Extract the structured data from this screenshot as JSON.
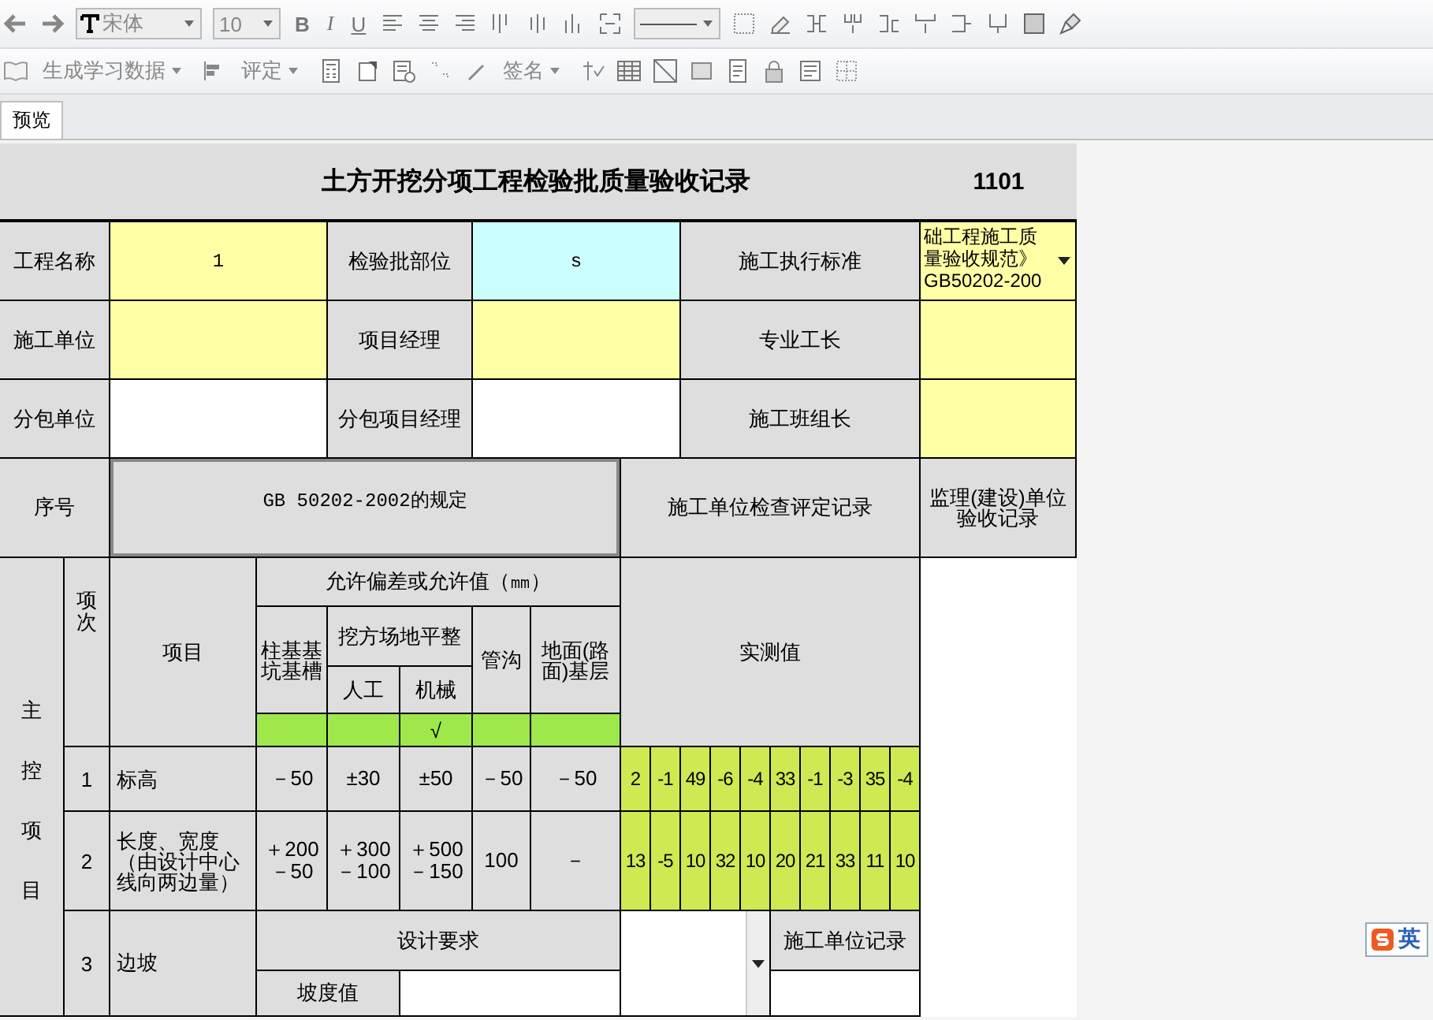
{
  "toolbar": {
    "font_name": "宋体",
    "font_size": "10",
    "bold": "B",
    "italic": "I",
    "underline": "U"
  },
  "toolbar2": {
    "generate": "生成学习数据",
    "evaluate": "评定",
    "sign": "签名"
  },
  "tabs": [
    {
      "label": "预览",
      "selected": true
    }
  ],
  "sheet": {
    "title": "土方开挖分项工程检验批质量验收记录",
    "code": "1101",
    "info_rows": [
      [
        {
          "label": "工程名称",
          "value": "1",
          "color": "#ffffa6",
          "kind": "text"
        },
        {
          "label": "检验批部位",
          "value": "s",
          "color": "#ccffff",
          "kind": "text"
        },
        {
          "label": "施工执行标准",
          "value": "础工程施工质量验收规范》GB50202-200",
          "color": "#ffffa6",
          "kind": "dropdown"
        }
      ],
      [
        {
          "label": "施工单位",
          "color": "#ffffa6",
          "kind": "text"
        },
        {
          "label": "项目经理",
          "color": "#ffffa6",
          "kind": "text"
        },
        {
          "label": "专业工长",
          "color": "#ffffa6",
          "kind": "text"
        }
      ],
      [
        {
          "label": "分包单位",
          "color": "#ffffff",
          "kind": "text"
        },
        {
          "label": "分包项目经理",
          "color": "#ffffff",
          "kind": "text"
        },
        {
          "label": "施工班组长",
          "color": "#ffffa6",
          "kind": "text"
        }
      ]
    ],
    "header": {
      "seq": "序号",
      "spec": "GB 50202-2002的规定",
      "check": "施工单位检查评定记录",
      "supervision": "监理(建设)单位验收记录"
    },
    "main": {
      "group_label": "主控项目",
      "item_no": "项次",
      "item": "项目",
      "tolerance": "允许偏差或允许值（㎜）",
      "excavation_group": "挖方场地平整",
      "measured_label": "实测值",
      "mark": "√",
      "tolerance_columns": [
        {
          "label": "柱基基坑基槽",
          "kind": "single",
          "checked": false
        },
        {
          "label": "人工",
          "kind": "sub",
          "checked": false
        },
        {
          "label": "机械",
          "kind": "sub",
          "checked": true
        },
        {
          "label": "管沟",
          "kind": "single",
          "checked": false
        },
        {
          "label": "地面(路面)基层",
          "kind": "single",
          "checked": false
        }
      ],
      "items": [
        {
          "no": "1",
          "name": "标高",
          "tolerances": [
            [
              "－50"
            ],
            [
              "±30"
            ],
            [
              "±50"
            ],
            [
              "－50"
            ],
            [
              "－50"
            ]
          ],
          "measured": [
            "2",
            "-1",
            "49",
            "-6",
            "-4",
            "33",
            "-1",
            "-3",
            "35",
            "-4"
          ]
        },
        {
          "no": "2",
          "name": "长度、宽度（由设计中心线向两边量）",
          "tolerances": [
            [
              "＋200",
              "－50"
            ],
            [
              "＋300",
              "－100"
            ],
            [
              "＋500",
              "－150"
            ],
            [
              "100"
            ],
            [
              "－"
            ]
          ],
          "measured": [
            "13",
            "-5",
            "10",
            "32",
            "10",
            "20",
            "21",
            "33",
            "11",
            "10"
          ]
        }
      ],
      "slope": {
        "no": "3",
        "name": "边坡",
        "design_label": "设计要求",
        "slope_label": "坡度值",
        "record_label": "施工单位记录"
      }
    }
  },
  "ime": {
    "label": "英"
  }
}
